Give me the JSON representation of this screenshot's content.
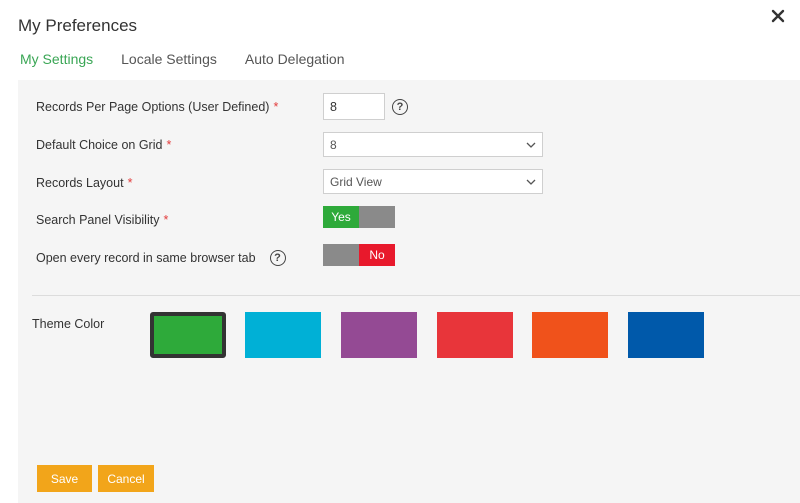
{
  "dialog": {
    "title": "My Preferences"
  },
  "tabs": [
    {
      "label": "My Settings",
      "active": true
    },
    {
      "label": "Locale Settings",
      "active": false
    },
    {
      "label": "Auto Delegation",
      "active": false
    }
  ],
  "fields": {
    "records_per_page": {
      "label": "Records Per Page Options (User Defined)",
      "value": "8",
      "required": "*"
    },
    "default_choice": {
      "label": "Default Choice on Grid",
      "value": "8",
      "required": "*"
    },
    "records_layout": {
      "label": "Records Layout",
      "value": "Grid View",
      "required": "*"
    },
    "search_panel": {
      "label": "Search Panel Visibility",
      "required": "*",
      "on_label": "Yes",
      "state": "on"
    },
    "open_same_tab": {
      "label": "Open every record in same browser tab",
      "off_label": "No",
      "state": "off"
    }
  },
  "theme": {
    "label": "Theme Color",
    "swatches": [
      {
        "name": "green",
        "color": "#2eaa3a",
        "selected": true
      },
      {
        "name": "cyan",
        "color": "#00b0d6",
        "selected": false
      },
      {
        "name": "purple",
        "color": "#944a94",
        "selected": false
      },
      {
        "name": "red",
        "color": "#e8353a",
        "selected": false
      },
      {
        "name": "orange",
        "color": "#f0521b",
        "selected": false
      },
      {
        "name": "blue",
        "color": "#0059aa",
        "selected": false
      }
    ]
  },
  "buttons": {
    "save": "Save",
    "cancel": "Cancel"
  },
  "icons": {
    "close": "close-icon",
    "help": "help-icon",
    "dropdown": "chevron-down-icon"
  },
  "colors": {
    "accent": "#3aa655",
    "yes": "#2eaa3a",
    "no": "#e8192c",
    "toggle_off": "#8a8a8a",
    "button": "#f2a51a",
    "required": "#e23b3b"
  }
}
